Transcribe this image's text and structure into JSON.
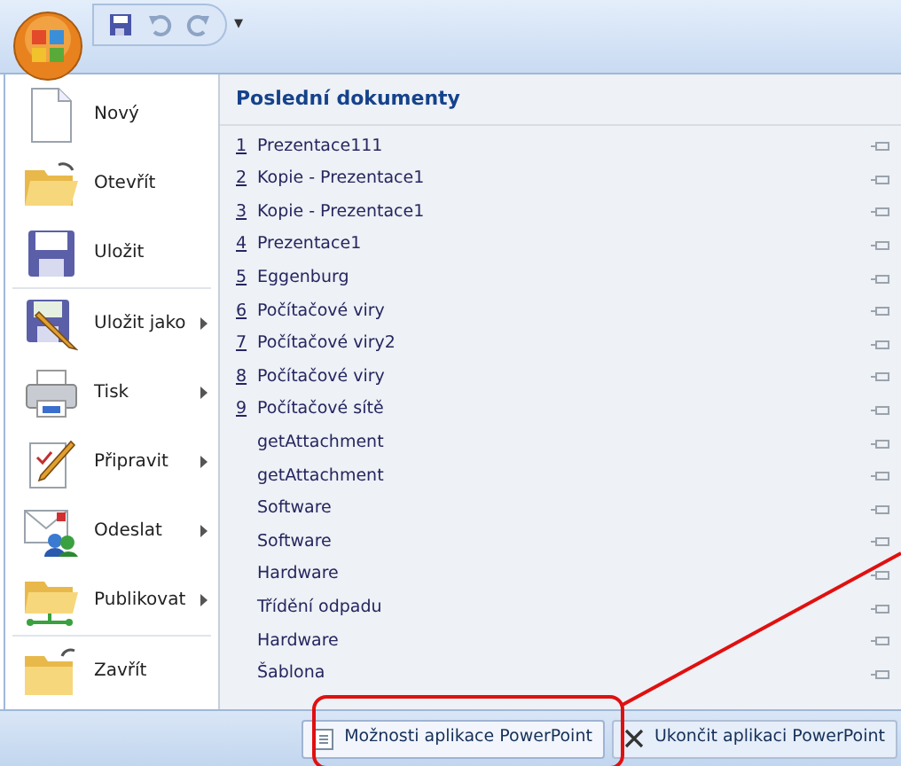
{
  "quick_access": {
    "overflow": "▾"
  },
  "commands": [
    {
      "label": "Nový",
      "kind": "new",
      "submenu": false
    },
    {
      "label": "Otevřít",
      "kind": "open",
      "submenu": false
    },
    {
      "label": "Uložit",
      "kind": "save",
      "submenu": false
    },
    {
      "label": "Uložit jako",
      "kind": "saveas",
      "submenu": true
    },
    {
      "label": "Tisk",
      "kind": "print",
      "submenu": true
    },
    {
      "label": "Připravit",
      "kind": "prepare",
      "submenu": true
    },
    {
      "label": "Odeslat",
      "kind": "send",
      "submenu": true
    },
    {
      "label": "Publikovat",
      "kind": "publish",
      "submenu": true
    },
    {
      "label": "Zavřít",
      "kind": "close",
      "submenu": false
    }
  ],
  "recent": {
    "title": "Poslední dokumenty",
    "items": [
      {
        "number": "1",
        "name": "Prezentace111"
      },
      {
        "number": "2",
        "name": "Kopie - Prezentace1"
      },
      {
        "number": "3",
        "name": "Kopie - Prezentace1"
      },
      {
        "number": "4",
        "name": "Prezentace1"
      },
      {
        "number": "5",
        "name": "Eggenburg"
      },
      {
        "number": "6",
        "name": "Počítačové viry"
      },
      {
        "number": "7",
        "name": "Počítačové viry2"
      },
      {
        "number": "8",
        "name": "Počítačové viry"
      },
      {
        "number": "9",
        "name": "Počítačové sítě"
      },
      {
        "name": "getAttachment"
      },
      {
        "name": "getAttachment"
      },
      {
        "name": "Software"
      },
      {
        "name": "Software"
      },
      {
        "name": "Hardware"
      },
      {
        "name": "Třídění odpadu"
      },
      {
        "name": "Hardware"
      },
      {
        "name": "Šablona"
      }
    ]
  },
  "footer_buttons": [
    {
      "label": "Možnosti aplikace PowerPoint",
      "kind": "options",
      "highlighted": true
    },
    {
      "label": "Ukončit aplikaci PowerPoint",
      "kind": "exit",
      "highlighted": false
    }
  ]
}
